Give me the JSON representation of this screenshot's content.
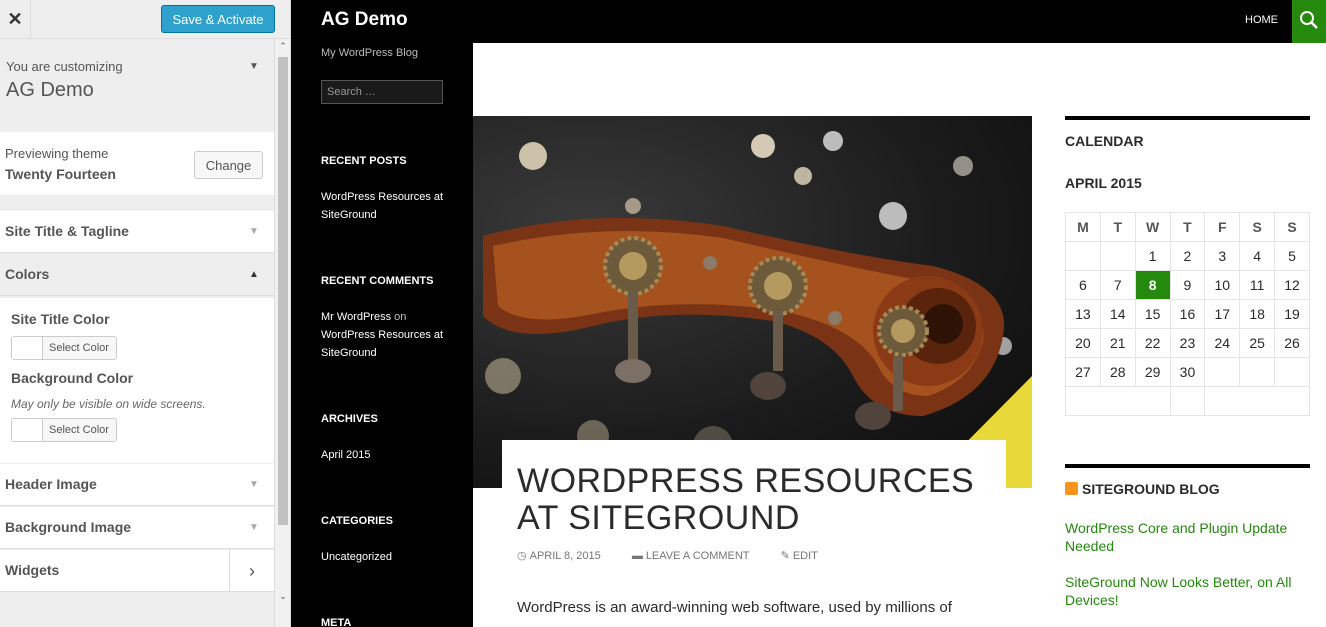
{
  "customizer": {
    "close_label": "✕",
    "save_label": "Save & Activate",
    "customizing_label": "You are customizing",
    "site_name": "AG Demo",
    "previewing_label": "Previewing theme",
    "theme_name": "Twenty Fourteen",
    "change_label": "Change",
    "sections": [
      {
        "label": "Site Title & Tagline",
        "open": false
      },
      {
        "label": "Colors",
        "open": true
      },
      {
        "label": "Header Image",
        "open": false
      },
      {
        "label": "Background Image",
        "open": false
      },
      {
        "label": "Widgets",
        "open": false
      }
    ],
    "colors": {
      "site_title_color_label": "Site Title Color",
      "background_color_label": "Background Color",
      "background_desc": "May only be visible on wide screens.",
      "select_color_label": "Select Color"
    }
  },
  "site": {
    "title": "AG Demo",
    "tagline": "My WordPress Blog",
    "search_placeholder": "Search …",
    "nav_home": "HOME"
  },
  "left_widgets": {
    "recent_posts": {
      "title": "RECENT POSTS",
      "items": [
        "WordPress Resources at SiteGround"
      ]
    },
    "recent_comments": {
      "title": "RECENT COMMENTS",
      "author": "Mr WordPress",
      "on": "on",
      "post": "WordPress Resources at SiteGround"
    },
    "archives": {
      "title": "ARCHIVES",
      "items": [
        "April 2015"
      ]
    },
    "categories": {
      "title": "CATEGORIES",
      "items": [
        "Uncategorized"
      ]
    },
    "meta": {
      "title": "META"
    }
  },
  "post": {
    "title": "WORDPRESS RESOURCES AT SITEGROUND",
    "date": "APRIL 8, 2015",
    "comment_link": "LEAVE A COMMENT",
    "edit_link": "EDIT",
    "excerpt": "WordPress is an award-winning web software, used by millions of"
  },
  "right_sidebar": {
    "calendar_title": "CALENDAR",
    "month": "APRIL 2015",
    "weekdays": [
      "M",
      "T",
      "W",
      "T",
      "F",
      "S",
      "S"
    ],
    "weeks": [
      [
        "",
        "",
        "1",
        "2",
        "3",
        "4",
        "5"
      ],
      [
        "6",
        "7",
        "8",
        "9",
        "10",
        "11",
        "12"
      ],
      [
        "13",
        "14",
        "15",
        "16",
        "17",
        "18",
        "19"
      ],
      [
        "20",
        "21",
        "22",
        "23",
        "24",
        "25",
        "26"
      ],
      [
        "27",
        "28",
        "29",
        "30",
        "",
        "",
        ""
      ]
    ],
    "today": "8",
    "blog_title": "SITEGROUND BLOG",
    "blog_links": [
      "WordPress Core and Plugin Update Needed",
      "SiteGround Now Looks Better, on All Devices!"
    ]
  },
  "colors": {
    "accent_green": "#24890d",
    "save_blue": "#2ea2cc"
  }
}
